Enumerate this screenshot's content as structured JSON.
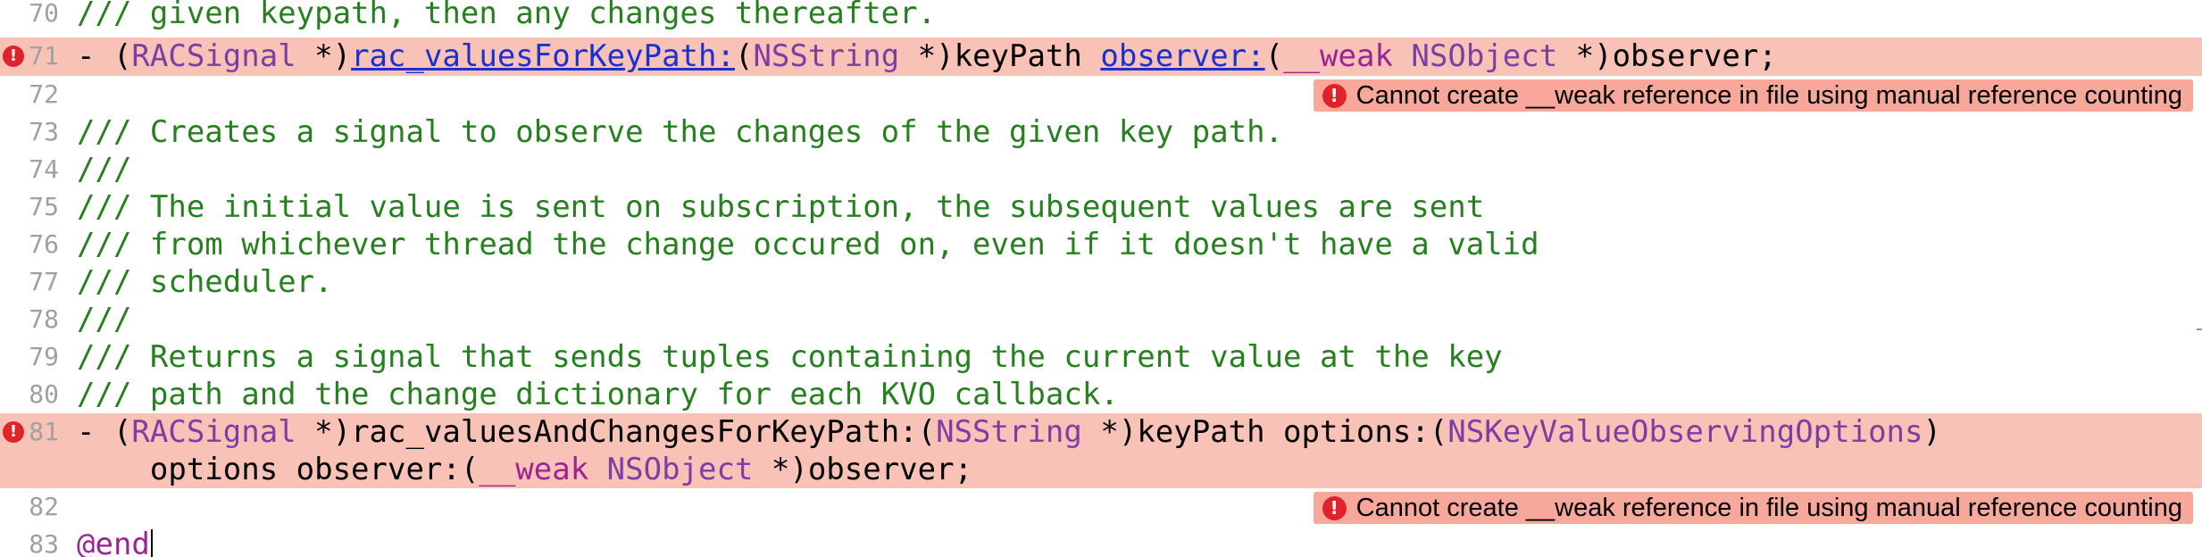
{
  "editor": {
    "lines": {
      "l70": {
        "num": "70",
        "text": "/// given keypath, then any changes thereafter."
      },
      "l71": {
        "num": "71",
        "parts": {
          "dash": "- (",
          "type1": "RACSignal",
          "star1": " *)",
          "method1": "rac_valuesForKeyPath:",
          "paren1": "(",
          "type2": "NSString",
          "star2": " *)keyPath ",
          "method2": "observer:",
          "paren2": "(",
          "weak": "__weak",
          "space": " ",
          "type3": "NSObject",
          "end": " *)observer;"
        }
      },
      "l72": {
        "num": "72",
        "error": "Cannot create __weak reference in file using manual reference counting"
      },
      "l73": {
        "num": "73",
        "text": "/// Creates a signal to observe the changes of the given key path."
      },
      "l74": {
        "num": "74",
        "text": "///"
      },
      "l75": {
        "num": "75",
        "text": "/// The initial value is sent on subscription, the subsequent values are sent"
      },
      "l76": {
        "num": "76",
        "text": "/// from whichever thread the change occured on, even if it doesn't have a valid"
      },
      "l77": {
        "num": "77",
        "text": "/// scheduler."
      },
      "l78": {
        "num": "78",
        "text": "///"
      },
      "l79": {
        "num": "79",
        "text": "/// Returns a signal that sends tuples containing the current value at the key"
      },
      "l80": {
        "num": "80",
        "text": "/// path and the change dictionary for each KVO callback."
      },
      "l81": {
        "num": "81",
        "parts": {
          "dash": "- (",
          "type1": "RACSignal",
          "mid1": " *)rac_valuesAndChangesForKeyPath:(",
          "type2": "NSString",
          "mid2": " *)keyPath options:(",
          "type3": "NSKeyValueObservingOptions",
          "end1": ")"
        },
        "cont": {
          "start": "    options observer:(",
          "weak": "__weak",
          "space": " ",
          "type": "NSObject",
          "end": " *)observer;"
        }
      },
      "l82": {
        "num": "82",
        "error": "Cannot create __weak reference in file using manual reference counting"
      },
      "l83": {
        "num": "83",
        "text": "@end"
      }
    },
    "error_marker": "!",
    "colors": {
      "comment": "#26801f",
      "type": "#7b3fa3",
      "keyword": "#9b2393",
      "link": "#1b2fd3",
      "error_line": "#f9c2b6",
      "error_badge": "#f8a89b",
      "error_icon": "#e0222b"
    }
  }
}
